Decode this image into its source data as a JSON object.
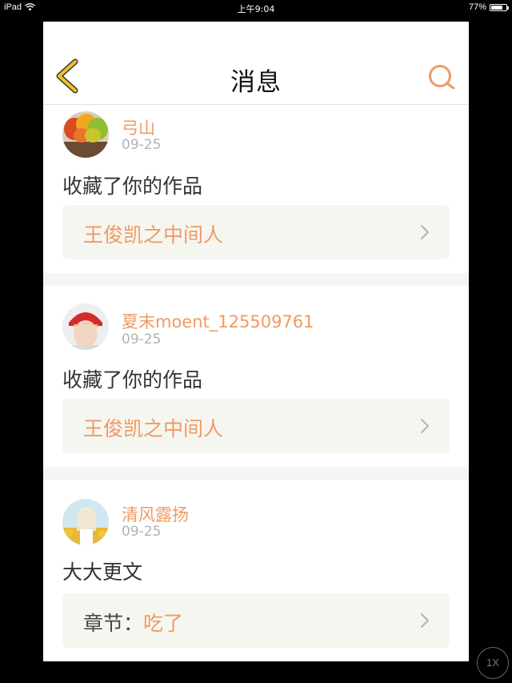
{
  "status_bar": {
    "device": "iPad",
    "time": "上午9:04",
    "battery": "77%",
    "battery_level": 0.77,
    "wifi_icon": "wifi-icon"
  },
  "nav": {
    "title": "消息",
    "back_icon": "chevron-left-icon",
    "search_icon": "search-icon",
    "accent_color": "#f09a63",
    "back_color": "#e8c13b"
  },
  "messages": [
    {
      "username": "弓山",
      "date": "09-25",
      "action": "收藏了你的作品",
      "ref_prefix": "",
      "ref_title": "王俊凯之中间人"
    },
    {
      "username": "夏末moent_125509761",
      "date": "09-25",
      "action": "收藏了你的作品",
      "ref_prefix": "",
      "ref_title": "王俊凯之中间人"
    },
    {
      "username": "清风露扬",
      "date": "09-25",
      "action": "大大更文",
      "ref_prefix": "章节：",
      "ref_title": "吃了"
    }
  ],
  "zoom_badge": "1X"
}
